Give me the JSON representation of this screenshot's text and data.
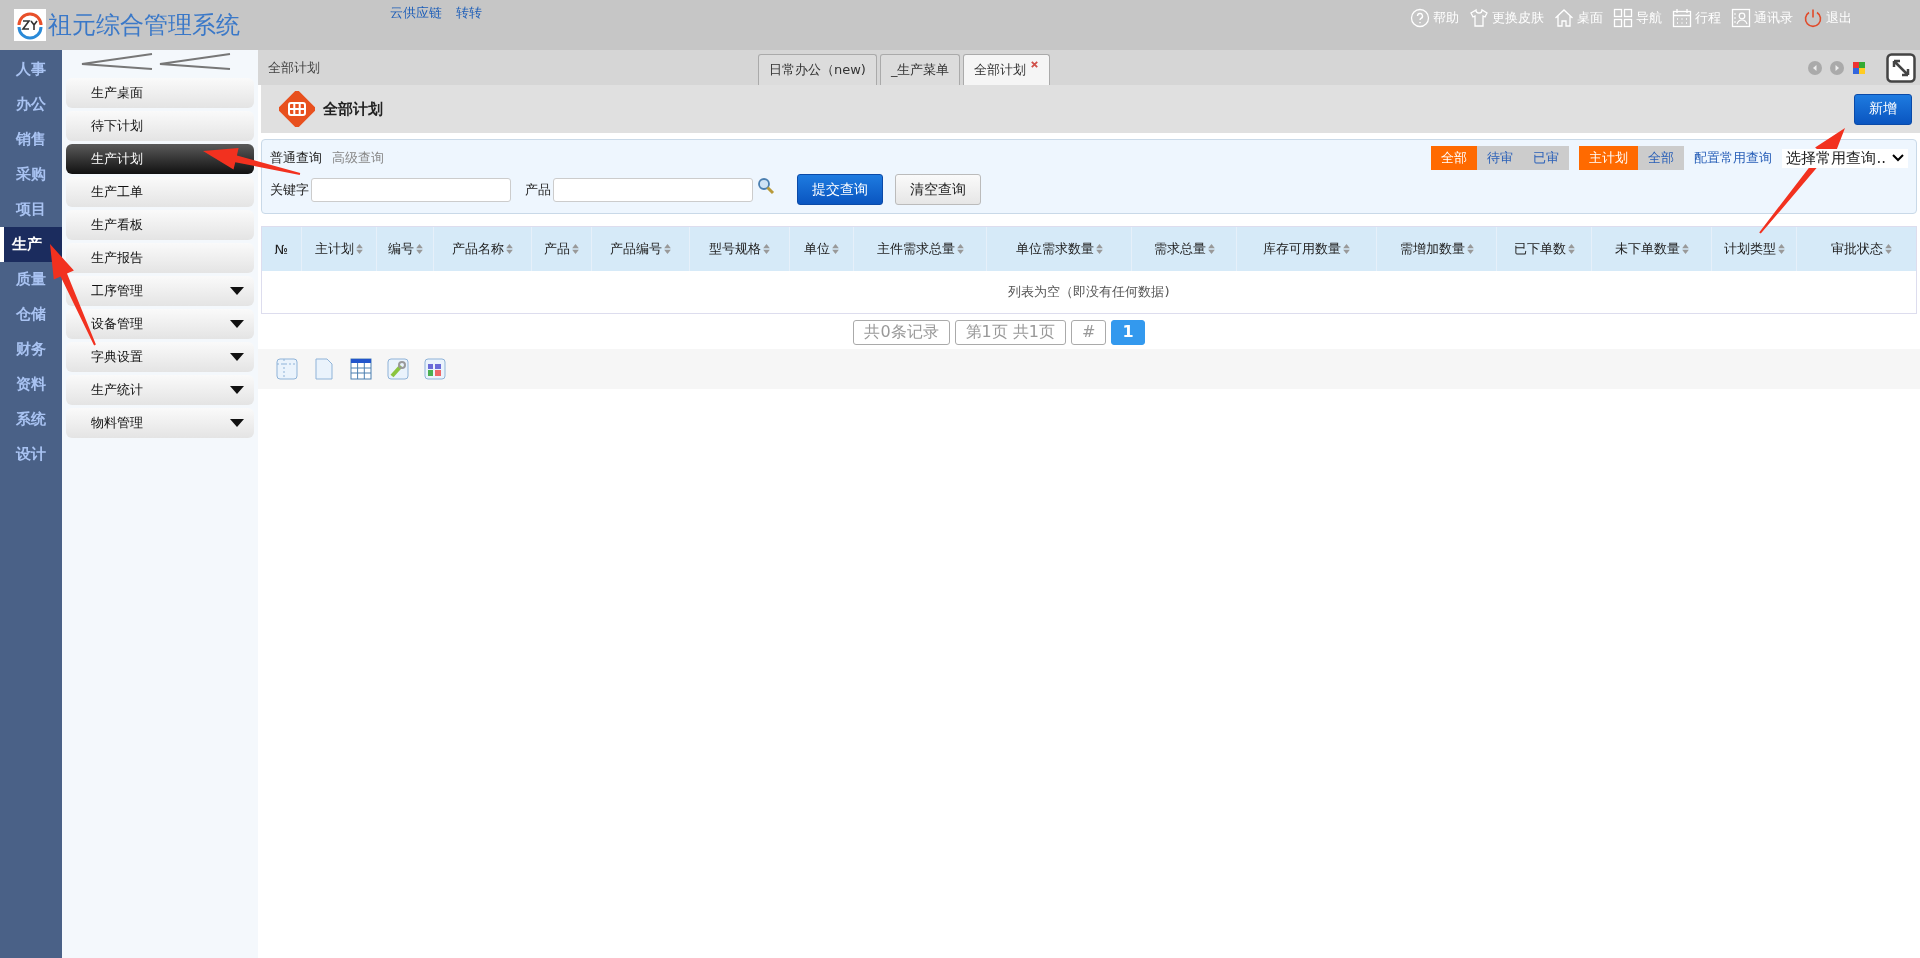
{
  "header": {
    "title": "祖元综合管理系统",
    "links": [
      "云供应链",
      "转转"
    ],
    "actions": [
      {
        "kind": "help",
        "label": "帮助"
      },
      {
        "kind": "skin",
        "label": "更换皮肤"
      },
      {
        "kind": "desktop",
        "label": "桌面"
      },
      {
        "kind": "nav",
        "label": "导航"
      },
      {
        "kind": "schedule",
        "label": "行程"
      },
      {
        "kind": "contacts",
        "label": "通讯录"
      },
      {
        "kind": "logout",
        "label": "退出"
      }
    ]
  },
  "nav": [
    {
      "label": "人事",
      "selected": false
    },
    {
      "label": "办公",
      "selected": false
    },
    {
      "label": "销售",
      "selected": false
    },
    {
      "label": "采购",
      "selected": false
    },
    {
      "label": "项目",
      "selected": false
    },
    {
      "label": "生产",
      "selected": true
    },
    {
      "label": "质量",
      "selected": false
    },
    {
      "label": "仓储",
      "selected": false
    },
    {
      "label": "财务",
      "selected": false
    },
    {
      "label": "资料",
      "selected": false
    },
    {
      "label": "系统",
      "selected": false
    },
    {
      "label": "设计",
      "selected": false
    }
  ],
  "menu": [
    {
      "label": "生产桌面",
      "selected": false,
      "expandable": false
    },
    {
      "label": "待下计划",
      "selected": false,
      "expandable": false
    },
    {
      "label": "生产计划",
      "selected": true,
      "expandable": false
    },
    {
      "label": "生产工单",
      "selected": false,
      "expandable": false
    },
    {
      "label": "生产看板",
      "selected": false,
      "expandable": false
    },
    {
      "label": "生产报告",
      "selected": false,
      "expandable": false
    },
    {
      "label": "工序管理",
      "selected": false,
      "expandable": true
    },
    {
      "label": "设备管理",
      "selected": false,
      "expandable": true
    },
    {
      "label": "字典设置",
      "selected": false,
      "expandable": true
    },
    {
      "label": "生产统计",
      "selected": false,
      "expandable": true
    },
    {
      "label": "物料管理",
      "selected": false,
      "expandable": true
    }
  ],
  "breadcrumb": "全部计划",
  "tabs": [
    {
      "label": "日常办公（new)",
      "selected": false,
      "closable": false
    },
    {
      "label": "_生产菜单",
      "selected": false,
      "closable": false
    },
    {
      "label": "全部计划",
      "selected": true,
      "closable": true
    }
  ],
  "page": {
    "title": "全部计划",
    "add_button": "新增"
  },
  "query": {
    "modes": [
      {
        "label": "普通查询",
        "selected": true
      },
      {
        "label": "高级查询",
        "selected": false
      }
    ],
    "fields": [
      {
        "label": "关键字",
        "lookup": false
      },
      {
        "label": "产品",
        "lookup": true
      }
    ],
    "submit": "提交查询",
    "clear": "清空查询",
    "status_filters": [
      {
        "label": "全部",
        "selected": true
      },
      {
        "label": "待审",
        "selected": false
      },
      {
        "label": "已审",
        "selected": false
      }
    ],
    "plan_filters": [
      {
        "label": "主计划",
        "selected": true
      },
      {
        "label": "全部",
        "selected": false
      }
    ],
    "config_link": "配置常用查询",
    "preset_select": "选择常用查询.."
  },
  "table": {
    "columns": [
      {
        "label": "№",
        "sortable": false
      },
      {
        "label": "主计划",
        "sortable": true
      },
      {
        "label": "编号",
        "sortable": true
      },
      {
        "label": "产品名称",
        "sortable": true
      },
      {
        "label": "产品",
        "sortable": true
      },
      {
        "label": "产品编号",
        "sortable": true
      },
      {
        "label": "型号规格",
        "sortable": true
      },
      {
        "label": "单位",
        "sortable": true
      },
      {
        "label": "主件需求总量",
        "sortable": true
      },
      {
        "label": "单位需求数量",
        "sortable": true
      },
      {
        "label": "需求总量",
        "sortable": true
      },
      {
        "label": "库存可用数量",
        "sortable": true
      },
      {
        "label": "需增加数量",
        "sortable": true
      },
      {
        "label": "已下单数",
        "sortable": true
      },
      {
        "label": "未下单数量",
        "sortable": true
      },
      {
        "label": "计划类型",
        "sortable": true
      },
      {
        "label": "审批状态",
        "sortable": true
      }
    ],
    "empty_text": "列表为空（即没有任何数据)"
  },
  "pager": {
    "total": "共0条记录",
    "page": "第1页 共1页",
    "jump": "#",
    "pages": [
      {
        "label": "1",
        "selected": true
      }
    ]
  }
}
